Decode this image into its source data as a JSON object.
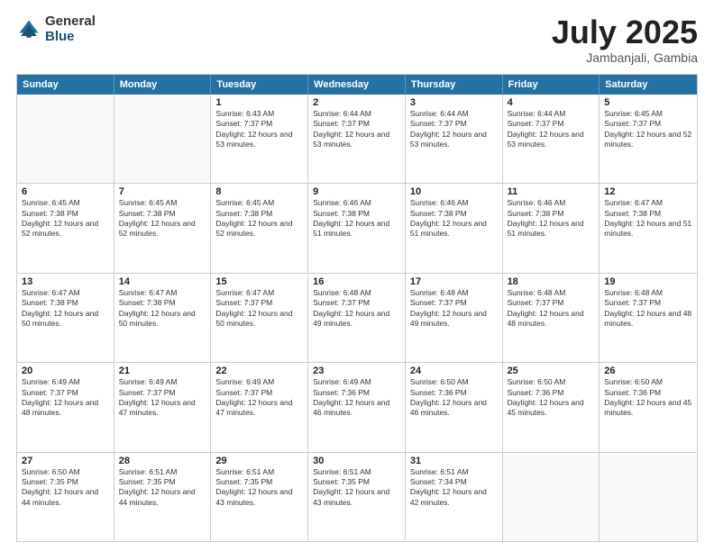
{
  "logo": {
    "general": "General",
    "blue": "Blue"
  },
  "title": "July 2025",
  "subtitle": "Jambanjali, Gambia",
  "header_days": [
    "Sunday",
    "Monday",
    "Tuesday",
    "Wednesday",
    "Thursday",
    "Friday",
    "Saturday"
  ],
  "weeks": [
    [
      {
        "day": "",
        "info": ""
      },
      {
        "day": "",
        "info": ""
      },
      {
        "day": "1",
        "info": "Sunrise: 6:43 AM\nSunset: 7:37 PM\nDaylight: 12 hours and 53 minutes."
      },
      {
        "day": "2",
        "info": "Sunrise: 6:44 AM\nSunset: 7:37 PM\nDaylight: 12 hours and 53 minutes."
      },
      {
        "day": "3",
        "info": "Sunrise: 6:44 AM\nSunset: 7:37 PM\nDaylight: 12 hours and 53 minutes."
      },
      {
        "day": "4",
        "info": "Sunrise: 6:44 AM\nSunset: 7:37 PM\nDaylight: 12 hours and 53 minutes."
      },
      {
        "day": "5",
        "info": "Sunrise: 6:45 AM\nSunset: 7:37 PM\nDaylight: 12 hours and 52 minutes."
      }
    ],
    [
      {
        "day": "6",
        "info": "Sunrise: 6:45 AM\nSunset: 7:38 PM\nDaylight: 12 hours and 52 minutes."
      },
      {
        "day": "7",
        "info": "Sunrise: 6:45 AM\nSunset: 7:38 PM\nDaylight: 12 hours and 52 minutes."
      },
      {
        "day": "8",
        "info": "Sunrise: 6:45 AM\nSunset: 7:38 PM\nDaylight: 12 hours and 52 minutes."
      },
      {
        "day": "9",
        "info": "Sunrise: 6:46 AM\nSunset: 7:38 PM\nDaylight: 12 hours and 51 minutes."
      },
      {
        "day": "10",
        "info": "Sunrise: 6:46 AM\nSunset: 7:38 PM\nDaylight: 12 hours and 51 minutes."
      },
      {
        "day": "11",
        "info": "Sunrise: 6:46 AM\nSunset: 7:38 PM\nDaylight: 12 hours and 51 minutes."
      },
      {
        "day": "12",
        "info": "Sunrise: 6:47 AM\nSunset: 7:38 PM\nDaylight: 12 hours and 51 minutes."
      }
    ],
    [
      {
        "day": "13",
        "info": "Sunrise: 6:47 AM\nSunset: 7:38 PM\nDaylight: 12 hours and 50 minutes."
      },
      {
        "day": "14",
        "info": "Sunrise: 6:47 AM\nSunset: 7:38 PM\nDaylight: 12 hours and 50 minutes."
      },
      {
        "day": "15",
        "info": "Sunrise: 6:47 AM\nSunset: 7:37 PM\nDaylight: 12 hours and 50 minutes."
      },
      {
        "day": "16",
        "info": "Sunrise: 6:48 AM\nSunset: 7:37 PM\nDaylight: 12 hours and 49 minutes."
      },
      {
        "day": "17",
        "info": "Sunrise: 6:48 AM\nSunset: 7:37 PM\nDaylight: 12 hours and 49 minutes."
      },
      {
        "day": "18",
        "info": "Sunrise: 6:48 AM\nSunset: 7:37 PM\nDaylight: 12 hours and 48 minutes."
      },
      {
        "day": "19",
        "info": "Sunrise: 6:48 AM\nSunset: 7:37 PM\nDaylight: 12 hours and 48 minutes."
      }
    ],
    [
      {
        "day": "20",
        "info": "Sunrise: 6:49 AM\nSunset: 7:37 PM\nDaylight: 12 hours and 48 minutes."
      },
      {
        "day": "21",
        "info": "Sunrise: 6:49 AM\nSunset: 7:37 PM\nDaylight: 12 hours and 47 minutes."
      },
      {
        "day": "22",
        "info": "Sunrise: 6:49 AM\nSunset: 7:37 PM\nDaylight: 12 hours and 47 minutes."
      },
      {
        "day": "23",
        "info": "Sunrise: 6:49 AM\nSunset: 7:36 PM\nDaylight: 12 hours and 46 minutes."
      },
      {
        "day": "24",
        "info": "Sunrise: 6:50 AM\nSunset: 7:36 PM\nDaylight: 12 hours and 46 minutes."
      },
      {
        "day": "25",
        "info": "Sunrise: 6:50 AM\nSunset: 7:36 PM\nDaylight: 12 hours and 45 minutes."
      },
      {
        "day": "26",
        "info": "Sunrise: 6:50 AM\nSunset: 7:36 PM\nDaylight: 12 hours and 45 minutes."
      }
    ],
    [
      {
        "day": "27",
        "info": "Sunrise: 6:50 AM\nSunset: 7:35 PM\nDaylight: 12 hours and 44 minutes."
      },
      {
        "day": "28",
        "info": "Sunrise: 6:51 AM\nSunset: 7:35 PM\nDaylight: 12 hours and 44 minutes."
      },
      {
        "day": "29",
        "info": "Sunrise: 6:51 AM\nSunset: 7:35 PM\nDaylight: 12 hours and 43 minutes."
      },
      {
        "day": "30",
        "info": "Sunrise: 6:51 AM\nSunset: 7:35 PM\nDaylight: 12 hours and 43 minutes."
      },
      {
        "day": "31",
        "info": "Sunrise: 6:51 AM\nSunset: 7:34 PM\nDaylight: 12 hours and 42 minutes."
      },
      {
        "day": "",
        "info": ""
      },
      {
        "day": "",
        "info": ""
      }
    ]
  ]
}
